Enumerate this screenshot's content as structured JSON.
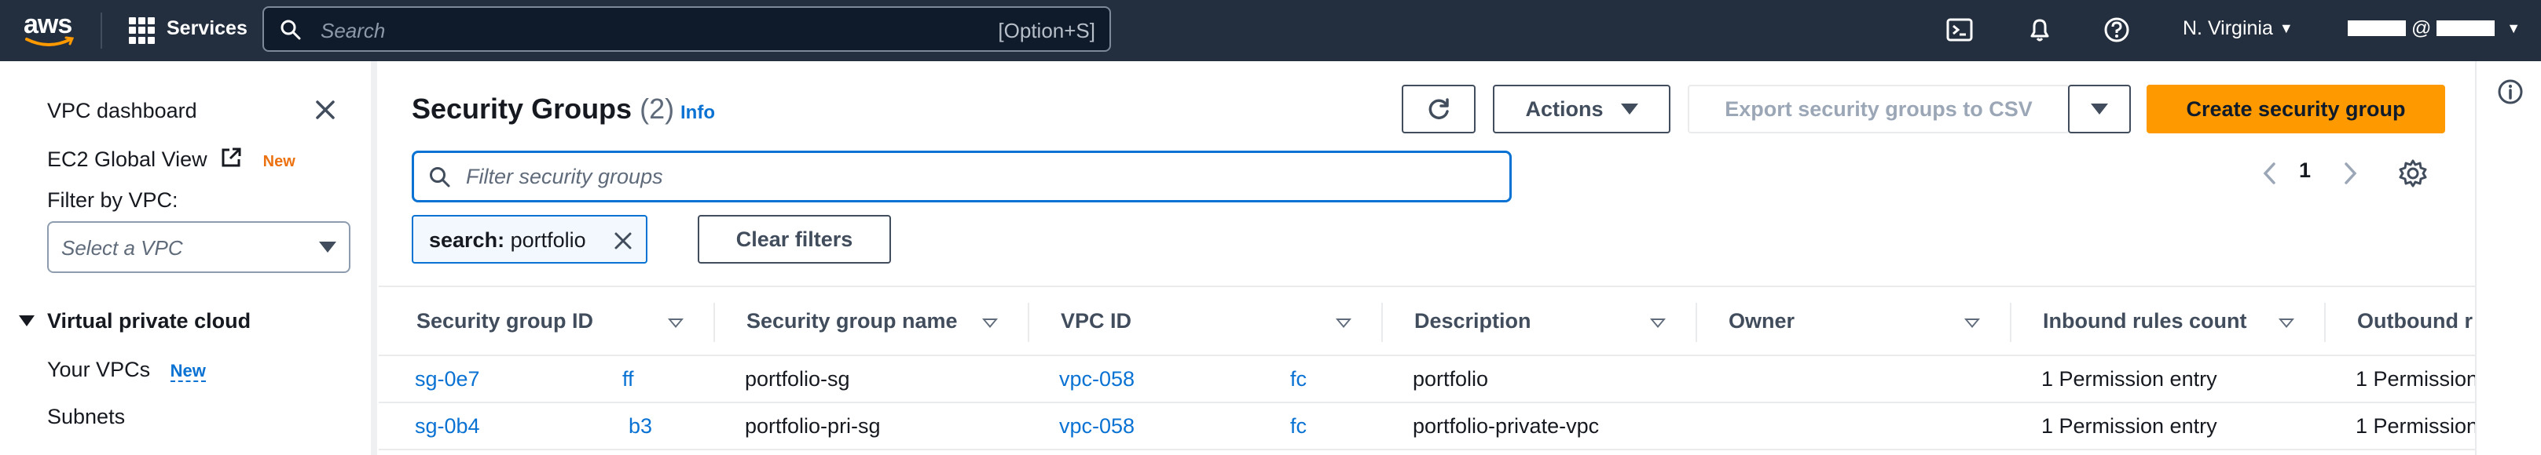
{
  "topnav": {
    "logo": "aws",
    "services_label": "Services",
    "search_placeholder": "Search",
    "search_shortcut": "[Option+S]",
    "region": "N. Virginia",
    "account_suffix": "@"
  },
  "sidebar": {
    "dashboard": "VPC dashboard",
    "global_view": "EC2 Global View",
    "global_view_badge": "New",
    "filter_label": "Filter by VPC:",
    "select_placeholder": "Select a VPC",
    "section": "Virtual private cloud",
    "items": [
      {
        "label": "Your VPCs",
        "badge": "New"
      },
      {
        "label": "Subnets",
        "badge": ""
      }
    ]
  },
  "main": {
    "title": "Security Groups",
    "count": "(2)",
    "info": "Info",
    "actions_label": "Actions",
    "export_label": "Export security groups to CSV",
    "create_label": "Create security group",
    "filter_placeholder": "Filter security groups",
    "page_number": "1",
    "token_key": "search:",
    "token_value": "portfolio",
    "clear_filters": "Clear filters"
  },
  "table": {
    "columns": [
      "Security group ID",
      "Security group name",
      "VPC ID",
      "Description",
      "Owner",
      "Inbound rules count",
      "Outbound r"
    ],
    "rows": [
      {
        "sg_prefix": "sg-0e7",
        "sg_suffix": "ff",
        "name": "portfolio-sg",
        "vpc_prefix": "vpc-058",
        "vpc_suffix": "fc",
        "description": "portfolio",
        "owner": "",
        "inbound": "1 Permission entry",
        "outbound": "1 Permission"
      },
      {
        "sg_prefix": "sg-0b4",
        "sg_suffix": "b3",
        "name": "portfolio-pri-sg",
        "vpc_prefix": "vpc-058",
        "vpc_suffix": "fc",
        "description": "portfolio-private-vpc",
        "owner": "",
        "inbound": "1 Permission entry",
        "outbound": "1 Permission"
      }
    ]
  },
  "colors": {
    "nav_bg": "#232f3e",
    "link": "#0972d3",
    "primary": "#ff9900",
    "badge_orange": "#ec7211"
  },
  "icons": [
    "grid-icon",
    "search-icon",
    "cloudshell-icon",
    "bell-icon",
    "help-icon",
    "close-icon",
    "external-link-icon",
    "refresh-icon",
    "chevron-left-icon",
    "chevron-right-icon",
    "gear-icon",
    "info-icon"
  ]
}
